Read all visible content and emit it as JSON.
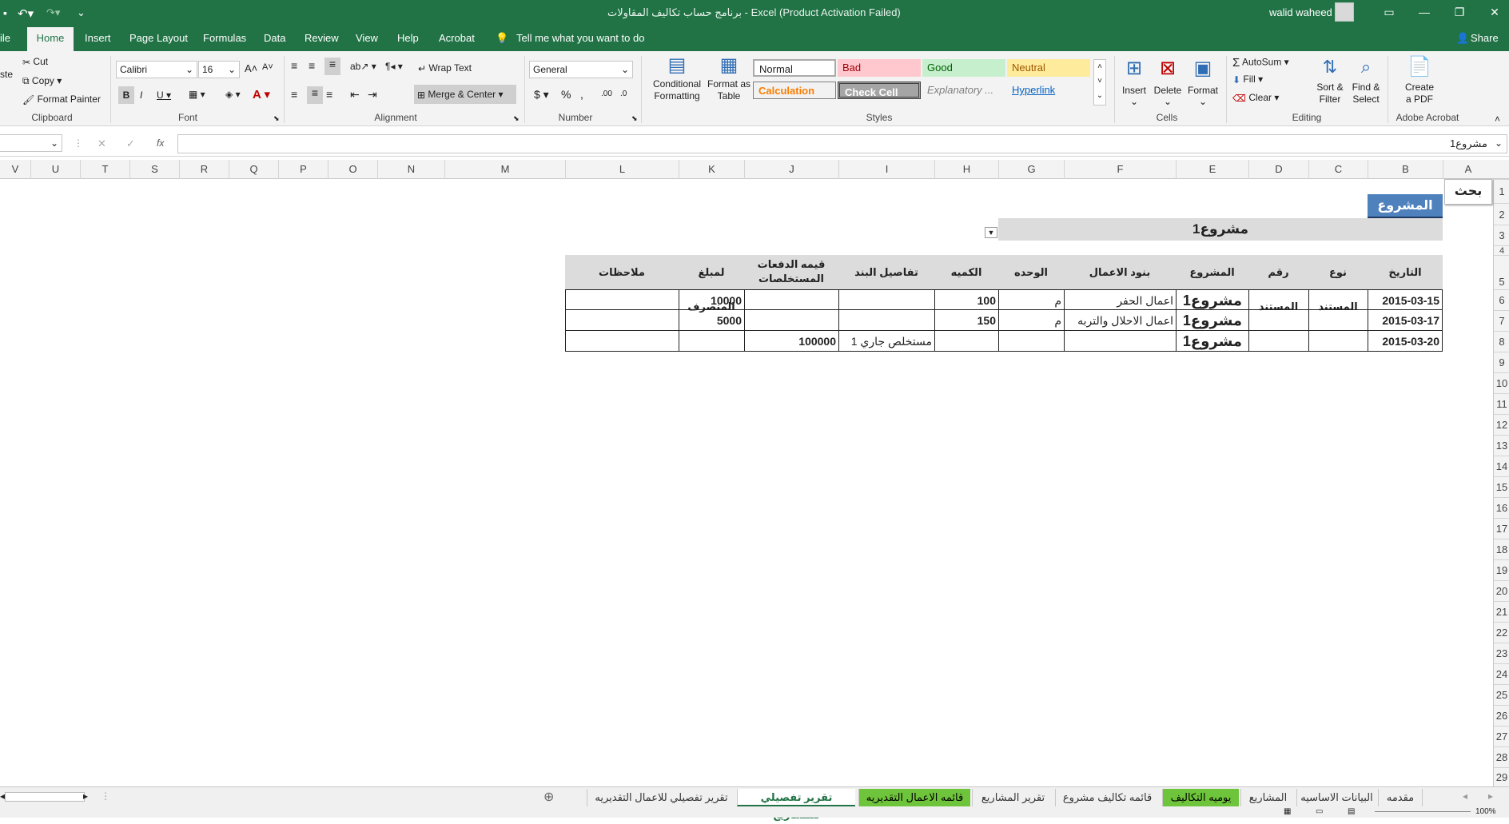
{
  "window": {
    "title": "برنامج حساب تكاليف المقاولات  -  Excel (Product Activation Failed)",
    "user": "walid waheed"
  },
  "colors": {
    "accent": "#217346",
    "header_blue": "#4f81bd",
    "tab_green": "#6ec43a"
  },
  "ribbon": {
    "tabs": [
      "ile",
      "Home",
      "Insert",
      "Page Layout",
      "Formulas",
      "Data",
      "Review",
      "View",
      "Help",
      "Acrobat"
    ],
    "tell_me": "Tell me what you want to do",
    "share": "Share",
    "clipboard": {
      "paste": "ste",
      "cut": "Cut",
      "copy": "Copy",
      "format_painter": "Format Painter",
      "label": "Clipboard"
    },
    "font": {
      "name": "Calibri",
      "size": "16",
      "label": "Font"
    },
    "alignment": {
      "wrap": "Wrap Text",
      "merge": "Merge & Center",
      "label": "Alignment"
    },
    "number": {
      "format": "General",
      "label": "Number"
    },
    "styles": {
      "conditional": "Conditional\nFormatting",
      "format_as_table": "Format as\nTable",
      "cells": {
        "normal": "Normal",
        "bad": "Bad",
        "good": "Good",
        "neutral": "Neutral",
        "calculation": "Calculation",
        "check_cell": "Check Cell",
        "explanatory": "Explanatory ...",
        "hyperlink": "Hyperlink"
      },
      "label": "Styles"
    },
    "cells": {
      "insert": "Insert",
      "delete": "Delete",
      "format": "Format",
      "label": "Cells"
    },
    "editing": {
      "autosum": "AutoSum",
      "fill": "Fill",
      "clear": "Clear",
      "sort_filter": "Sort &\nFilter",
      "find_select": "Find &\nSelect",
      "label": "Editing"
    },
    "acrobat": {
      "create_pdf": "Create\na PDF",
      "label": "Adobe Acrobat"
    }
  },
  "formula_bar": {
    "fx": "fx",
    "content": "مشروع1"
  },
  "columns": [
    "V",
    "U",
    "T",
    "S",
    "R",
    "Q",
    "P",
    "O",
    "N",
    "M",
    "L",
    "K",
    "J",
    "I",
    "H",
    "G",
    "F",
    "E",
    "D",
    "C",
    "B",
    "A"
  ],
  "rows": [
    "1",
    "2",
    "3",
    "4",
    "5",
    "6",
    "7",
    "8",
    "9",
    "10",
    "11",
    "12",
    "13",
    "14",
    "15",
    "16",
    "17",
    "18",
    "19",
    "20",
    "21",
    "22",
    "23",
    "24",
    "25",
    "26",
    "27",
    "28",
    "29"
  ],
  "sheet": {
    "search_label": "بحث",
    "project_label": "المشروع",
    "project_value": "مشروع1",
    "headers": {
      "date": "التاريخ",
      "doc_type": "نوع المستند",
      "doc_no": "رقم المستند",
      "project": "المشروع",
      "work_items": "بنود الاعمال",
      "unit": "الوحده",
      "qty": "الكميه",
      "item_details": "تفاصيل البند",
      "payments_1": "قيمه الدفعات",
      "payments_2": "المستخلصات",
      "spent": "لمبلغ المنصرف",
      "notes": "ملاحظات"
    },
    "rows": [
      {
        "date": "2015-03-15",
        "project": "مشروع1",
        "work_item": "اعمال الحفر",
        "unit": "م",
        "qty": "100",
        "details": "",
        "payment": "",
        "spent": "10000"
      },
      {
        "date": "2015-03-17",
        "project": "مشروع1",
        "work_item": "اعمال الاحلال والتربه",
        "unit": "م",
        "qty": "150",
        "details": "",
        "payment": "",
        "spent": "5000"
      },
      {
        "date": "2015-03-20",
        "project": "مشروع1",
        "work_item": "",
        "unit": "",
        "qty": "",
        "details": "مستخلص جاري 1",
        "payment": "100000",
        "spent": ""
      }
    ]
  },
  "sheet_tabs": [
    "تقرير تفصيلي للاعمال التقديريه",
    "تقرير تفصيلي للمشاريع",
    "قائمه الاعمال التقديريه",
    "تقرير المشاريع",
    "قائمه تكاليف مشروع",
    "يوميه التكاليف",
    "المشاريع",
    "البيانات الاساسيه",
    "مقدمه"
  ],
  "status": {
    "zoom": "100%"
  }
}
